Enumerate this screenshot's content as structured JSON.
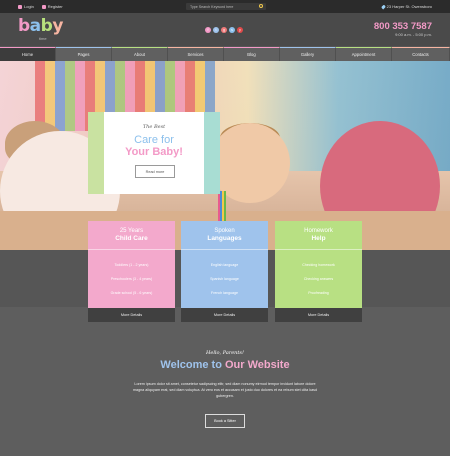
{
  "topbar": {
    "login": "Login",
    "register": "Register",
    "search_placeholder": "Type Search Keyword here",
    "address": "23 Harper St. Owensboro"
  },
  "header": {
    "logo": [
      "b",
      "a",
      "b",
      "y"
    ],
    "logo_sub": "time",
    "socials": [
      {
        "icon": "facebook-icon",
        "glyph": "f",
        "color": "#f39ac7"
      },
      {
        "icon": "twitter-icon",
        "glyph": "t",
        "color": "#9fc3ec"
      },
      {
        "icon": "googleplus-icon",
        "glyph": "g",
        "color": "#f07b7b"
      },
      {
        "icon": "skype-icon",
        "glyph": "s",
        "color": "#8cc0ec"
      },
      {
        "icon": "youtube-icon",
        "glyph": "y",
        "color": "#e04a4a"
      }
    ],
    "phone": "800 353 7587",
    "hours": "9:00 a.m. - 5:00 p.m."
  },
  "nav": [
    "Home",
    "Pages",
    "About",
    "Services",
    "Blog",
    "Gallery",
    "Appointment",
    "Contacts"
  ],
  "hero": {
    "subtitle": "The Best",
    "title_line1": "Care for",
    "title_line2": "Your Baby!",
    "button": "Read more"
  },
  "features": [
    {
      "head1": "25 Years",
      "head2": "Child Care",
      "rows": [
        "Toddlers (1 - 2 years)",
        "Preschoolers (3 - 4 years)",
        "Grade school (5 - 6 years)"
      ],
      "foot": "More Details"
    },
    {
      "head1": "Spoken",
      "head2": "Languages",
      "rows": [
        "English language",
        "Spanish language",
        "French language"
      ],
      "foot": "More Details"
    },
    {
      "head1": "Homework",
      "head2": "Help",
      "rows": [
        "Checking homework",
        "Checking answers",
        "Proofreading"
      ],
      "foot": "More Details"
    }
  ],
  "welcome": {
    "subtitle": "Hello, Parents!",
    "title_part1": "Welcome to",
    "title_part2": "Our Website",
    "text": "Lorem ipsum dolor sit amet, consetetur sadipscing elitr, sed diam nonumy eirmod tempor invidunt labore dolore magna aliquyam erat, sed diam voluptua. At vero eos et accusam et justo duo dolores et ea rebum stet clita kasd gubergren.",
    "button": "Book a Sitter"
  },
  "colors": {
    "pink": "#f3a9cc",
    "blue": "#9fc3ec",
    "green": "#b8e083",
    "phone": "#f39ac7"
  }
}
